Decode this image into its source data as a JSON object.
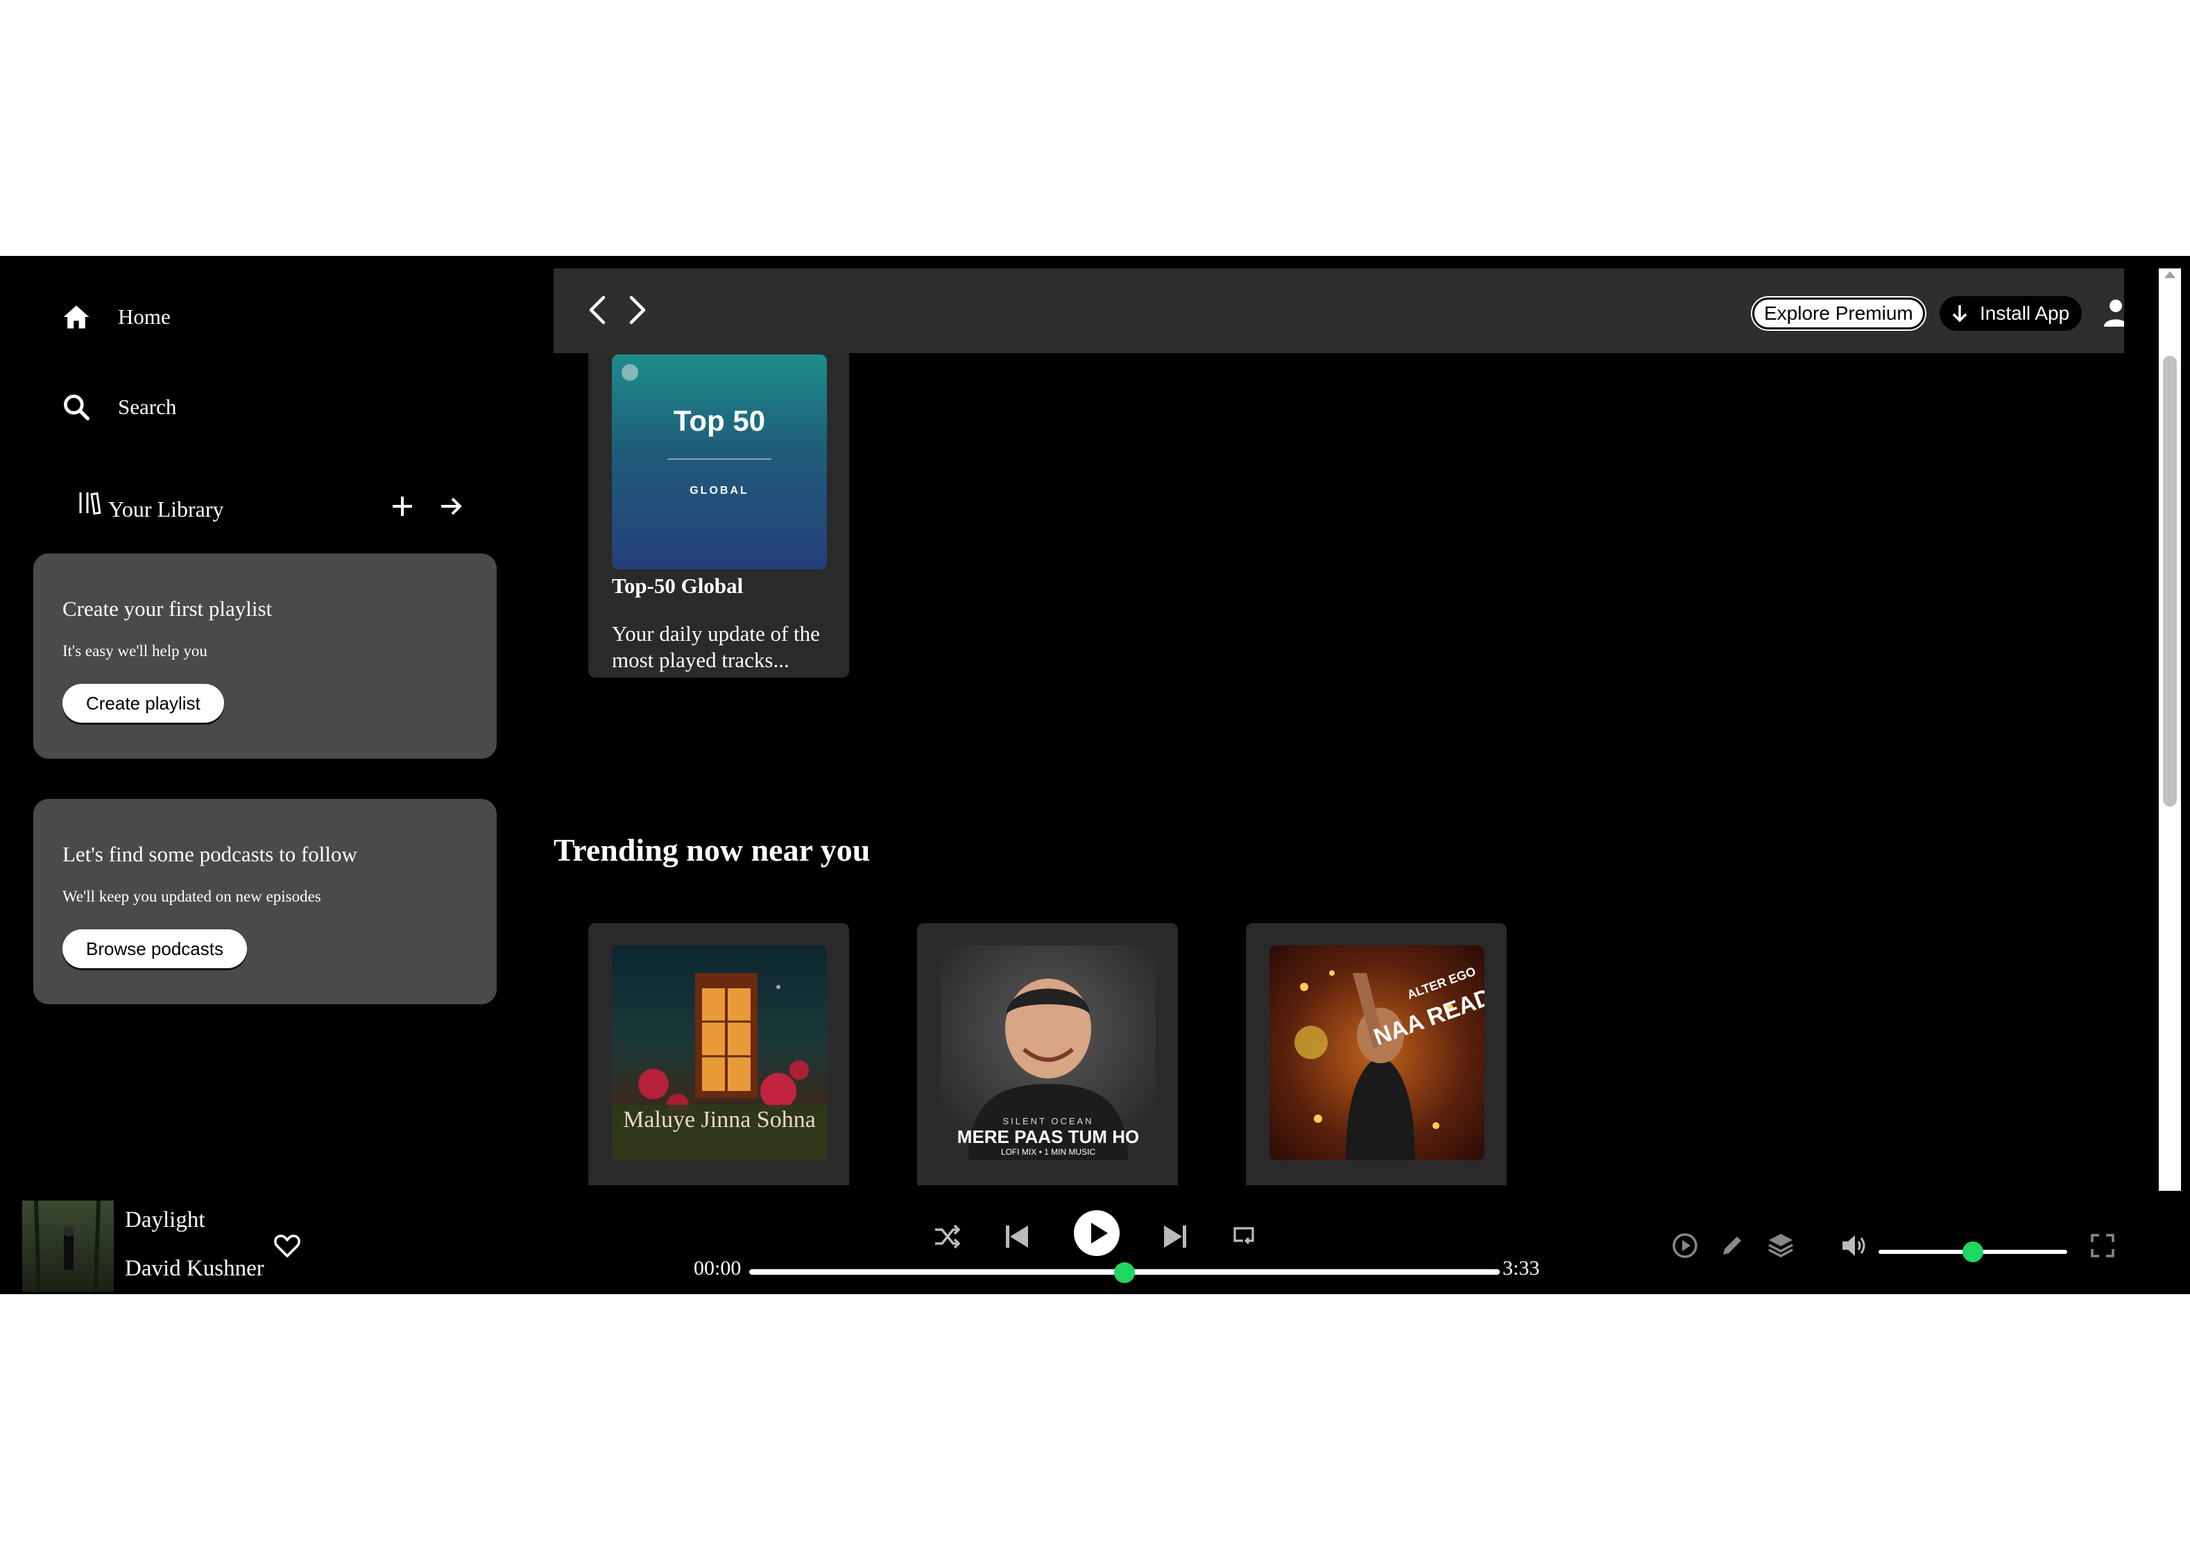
{
  "sidebar": {
    "home_label": "Home",
    "search_label": "Search",
    "library_label": "Your Library",
    "playlist_card": {
      "title": "Create your first playlist",
      "subtitle": "It's easy we'll help you",
      "button": "Create playlist"
    },
    "podcast_card": {
      "title": "Let's find some podcasts to follow",
      "subtitle": "We'll keep you updated on new episodes",
      "button": "Browse podcasts"
    }
  },
  "topbar": {
    "explore_premium": "Explore Premium",
    "install_app": "Install App"
  },
  "main": {
    "featured_card": {
      "cover_title": "Top 50",
      "cover_subtitle": "GLOBAL",
      "title": "Top-50 Global",
      "description": "Your daily update of the most played tracks..."
    },
    "section_title": "Trending now near you",
    "trending": [
      {
        "cover_text": "Maluye Jinna Sohna"
      },
      {
        "cover_top": "SILENT OCEAN",
        "cover_text": "MERE PAAS TUM HO",
        "cover_sub": "LOFI MIX • 1 MIN MUSIC"
      },
      {
        "cover_text": "NAA READY",
        "cover_top": "ALTER EGO"
      }
    ]
  },
  "player": {
    "title": "Daylight",
    "artist": "David Kushner",
    "current_time": "00:00",
    "total_time": "3:33",
    "progress_fraction": 0.5,
    "volume_fraction": 0.5
  },
  "colors": {
    "accent": "#1ed760",
    "card_bg": "#4a4a4a",
    "topbar_bg": "#2e2e2e"
  }
}
